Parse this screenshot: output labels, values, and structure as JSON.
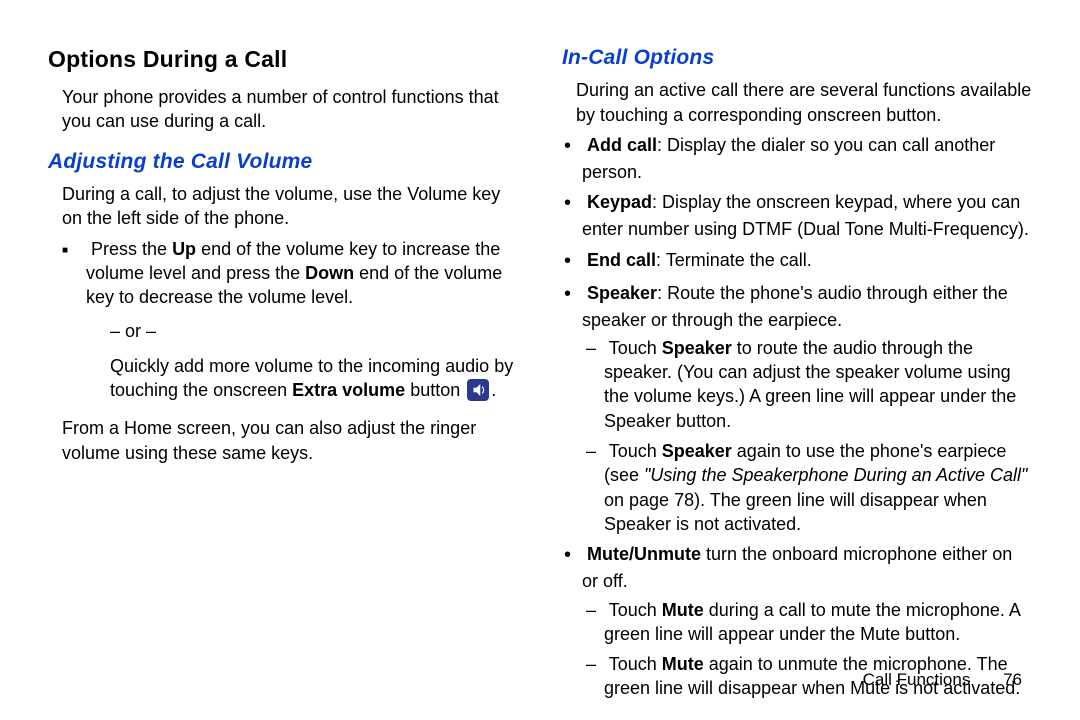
{
  "left": {
    "h1": "Options During a Call",
    "intro": "Your phone provides a number of control functions that you can use during a call.",
    "h2": "Adjusting the Call Volume",
    "p1": "During a call, to adjust the volume, use the Volume key on the left side of the phone.",
    "li1_a": "Press the ",
    "li1_b": "Up",
    "li1_c": " end of the volume key to increase the volume level and press the ",
    "li1_d": "Down",
    "li1_e": " end of the volume key to decrease the volume level.",
    "or": "– or –",
    "p2_a": "Quickly add more volume to the incoming audio by touching the onscreen ",
    "p2_b": "Extra volume",
    "p2_c": " button ",
    "p2_d": ".",
    "p3": "From a Home screen, you can also adjust the ringer volume using these same keys."
  },
  "right": {
    "h2": "In-Call Options",
    "intro": "During an active call there are several functions available by touching a corresponding onscreen button.",
    "b1_a": "Add call",
    "b1_b": ": Display the dialer so you can call another person.",
    "b2_a": "Keypad",
    "b2_b": ": Display the onscreen keypad, where you can enter number using DTMF (Dual Tone Multi-Frequency).",
    "b3_a": "End call",
    "b3_b": ": Terminate the call.",
    "b4_a": "Speaker",
    "b4_b": ": Route the phone's audio through either the speaker or through the earpiece.",
    "b4_d1_a": "Touch ",
    "b4_d1_b": "Speaker",
    "b4_d1_c": " to route the audio through the speaker. (You can adjust the speaker volume using the volume keys.) A green line will appear under the Speaker button.",
    "b4_d2_a": "Touch ",
    "b4_d2_b": "Speaker",
    "b4_d2_c": " again to use the phone's earpiece (see ",
    "b4_d2_d": "\"Using the Speakerphone During an Active Call\"",
    "b4_d2_e": " on page 78). The green line will disappear when Speaker is not activated.",
    "b5_a": "Mute/Unmute",
    "b5_b": " turn the onboard microphone either on or off.",
    "b5_d1_a": "Touch ",
    "b5_d1_b": "Mute",
    "b5_d1_c": " during a call to mute the microphone. A green line will appear under the Mute button.",
    "b5_d2_a": "Touch ",
    "b5_d2_b": "Mute",
    "b5_d2_c": " again to unmute the microphone. The green line will disappear when Mute is not activated."
  },
  "footer": {
    "section": "Call Functions",
    "page": "76"
  }
}
